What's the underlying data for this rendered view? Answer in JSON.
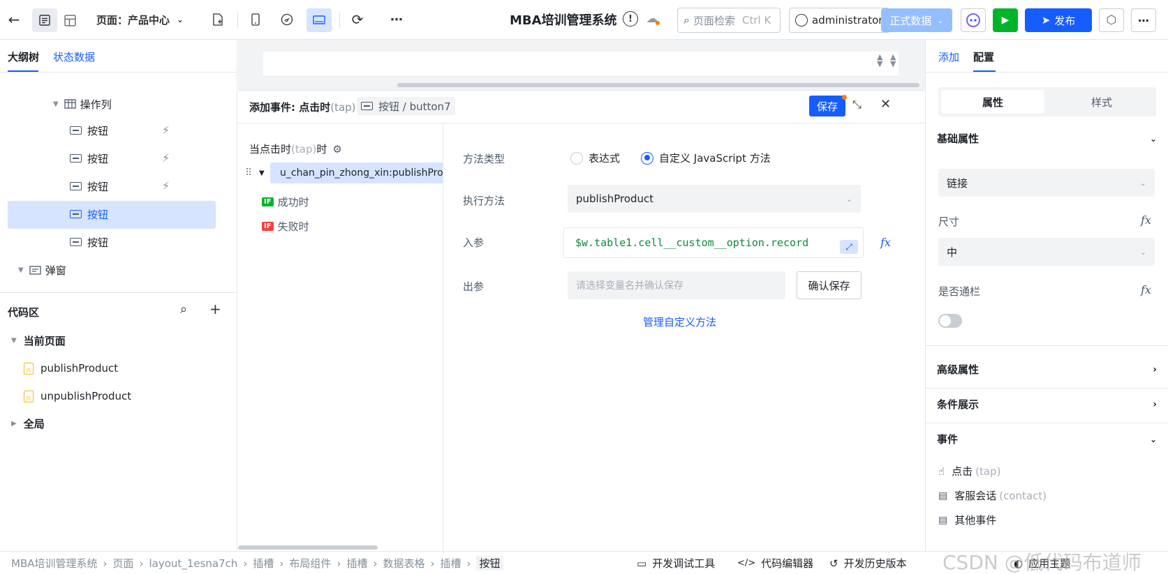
{
  "topbar": {
    "back_icon": "arrow-left-icon",
    "page_label": "页面：产品中心",
    "app_title": "MBA培训管理系统",
    "search_placeholder": "页面检索",
    "search_shortcut": "Ctrl K",
    "user": "administrator",
    "env_label": "正式数据",
    "publish_label": "发布"
  },
  "left": {
    "tabs": [
      "大纲树",
      "状态数据"
    ],
    "tree": {
      "action_column": "操作列",
      "buttons": [
        "按钮",
        "按钮",
        "按钮",
        "按钮",
        "按钮"
      ],
      "dialog": "弹窗"
    },
    "code": {
      "title": "代码区",
      "current_page": "当前页面",
      "files": [
        "publishProduct",
        "unpublishProduct"
      ],
      "global": "全局"
    }
  },
  "event": {
    "title": "添加事件: 点击时",
    "title_suffix": "(tap)",
    "target": "按钮 / button7",
    "save": "保存",
    "trigger": "当点击时",
    "trigger_suffix": "(tap)",
    "trigger_tail": "时",
    "action_node": "u_chan_pin_zhong_xin:publishProduct",
    "success": "成功时",
    "fail": "失败时",
    "if_badge": "IF",
    "method_type_label": "方法类型",
    "option_expr": "表达式",
    "option_js": "自定义 JavaScript 方法",
    "exec_label": "执行方法",
    "exec_value": "publishProduct",
    "input_label": "入参",
    "input_value": "$w.table1.cell__custom__option.record",
    "output_label": "出参",
    "output_placeholder": "请选择变量名并确认保存",
    "confirm_save": "确认保存",
    "manage_link": "管理自定义方法"
  },
  "right": {
    "tabs": [
      "添加",
      "配置"
    ],
    "subtabs": [
      "属性",
      "样式"
    ],
    "basic": "基础属性",
    "link_value": "链接",
    "size_label": "尺寸",
    "size_value": "中",
    "banner_label": "是否通栏",
    "advanced": "高级属性",
    "condition": "条件展示",
    "events": "事件",
    "event_click": "点击",
    "event_click_suffix": "(tap)",
    "event_contact": "客服会话",
    "event_contact_suffix": "(contact)",
    "event_other": "其他事件"
  },
  "bottom": {
    "breadcrumb": [
      "MBA培训管理系统",
      "页面",
      "layout_1esna7ch",
      "插槽",
      "布局组件",
      "插槽",
      "数据表格",
      "插槽",
      "按钮"
    ],
    "dev_tools": "开发调试工具",
    "code_editor": "代码编辑器",
    "history": "开发历史版本",
    "theme": "应用主题",
    "watermark": "CSDN @低代码布道师"
  },
  "colors": {
    "primary": "#165dff",
    "green": "#00b42a",
    "selected_bg": "#d6e4ff"
  }
}
